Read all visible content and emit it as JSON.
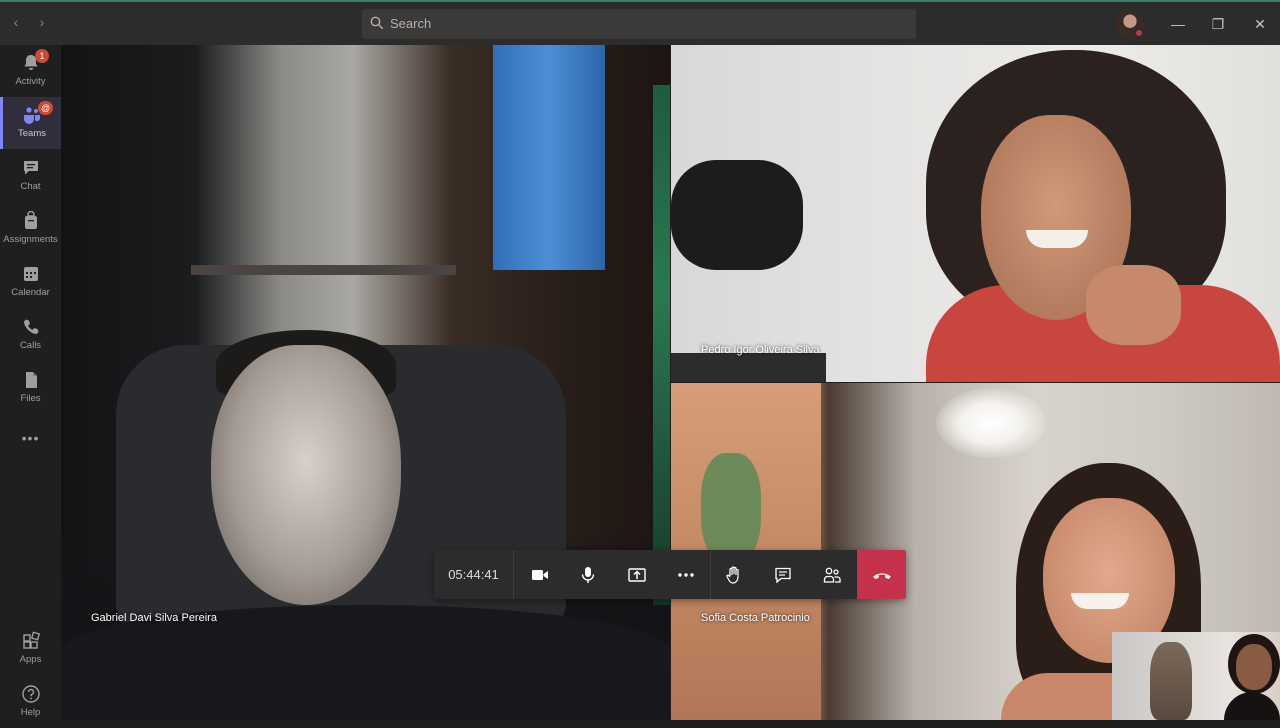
{
  "titlebar": {
    "search_placeholder": "Search",
    "icons": [
      "back-arrow-icon",
      "forward-arrow-icon",
      "search-icon",
      "minimize-icon",
      "restore-icon",
      "close-icon"
    ],
    "window_controls": {
      "minimize": "—",
      "restore": "❐",
      "close": "✕"
    },
    "nav": {
      "back": "‹",
      "forward": "›"
    }
  },
  "rail": {
    "items": [
      {
        "label": "Activity",
        "icon": "bell-icon",
        "badge": "1"
      },
      {
        "label": "Teams",
        "icon": "teams-icon",
        "badge": "@",
        "active": true
      },
      {
        "label": "Chat",
        "icon": "chat-icon"
      },
      {
        "label": "Assignments",
        "icon": "assignments-icon"
      },
      {
        "label": "Calendar",
        "icon": "calendar-icon"
      },
      {
        "label": "Calls",
        "icon": "phone-icon"
      },
      {
        "label": "Files",
        "icon": "files-icon"
      }
    ],
    "more": "•••",
    "bottom": [
      {
        "label": "Apps",
        "icon": "apps-icon"
      },
      {
        "label": "Help",
        "icon": "help-icon"
      }
    ],
    "accent": "#7f85f5"
  },
  "participants": {
    "gabriel": "Gabriel Davi Silva Pereira",
    "pedro": "Pedro Igor Oliveira Silva",
    "sofia": "Sofia Costa Patrocinio"
  },
  "call": {
    "timer": "05:44:41",
    "controls": [
      "camera-icon",
      "microphone-icon",
      "share-screen-icon",
      "more-options-icon",
      "raise-hand-icon",
      "conversation-icon",
      "participants-icon",
      "hang-up-icon"
    ],
    "hangup_color": "#c4314b"
  }
}
